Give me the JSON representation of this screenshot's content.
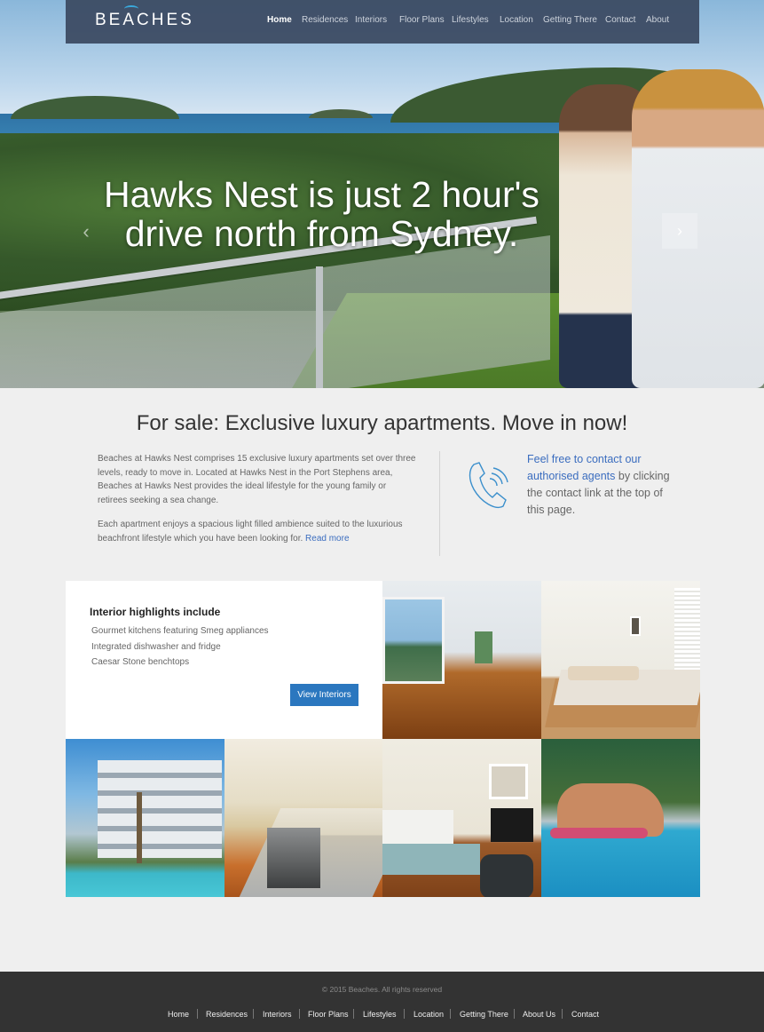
{
  "brand": {
    "logo_text": "BEACHES",
    "accent_color": "#39a9dc",
    "nav_bg": "#3a4860"
  },
  "nav": {
    "items": [
      {
        "label": "Home",
        "active": true
      },
      {
        "label": "Residences"
      },
      {
        "label": "Interiors"
      },
      {
        "label": "Floor Plans"
      },
      {
        "label": "Lifestyles"
      },
      {
        "label": "Location"
      },
      {
        "label": "Getting There"
      },
      {
        "label": "Contact"
      },
      {
        "label": "About"
      }
    ]
  },
  "hero": {
    "title_line1": "Hawks Nest is just 2 hour's",
    "title_line2": "drive north from Sydney.",
    "prev_icon": "chevron-left-icon",
    "next_icon": "chevron-right-icon",
    "prev_glyph": "‹",
    "next_glyph": "›"
  },
  "intro": {
    "title": "For sale: Exclusive luxury apartments. Move in now!",
    "paragraph1": "Beaches at Hawks Nest comprises 15 exclusive luxury apartments set over three levels, ready to move in. Located at Hawks Nest in the Port Stephens area, Beaches at Hawks Nest provides the ideal lifestyle for the young family or retirees seeking a sea change.",
    "paragraph2": "Each apartment enjoys a spacious light filled ambience suited to the luxurious beachfront lifestyle which you have been looking for.",
    "read_more": "Read more"
  },
  "contact": {
    "icon": "phone-icon",
    "link_text": "Feel free to contact our authorised agents",
    "rest_text": " by clicking the contact link at the top of this page."
  },
  "highlights": {
    "title": "Interior highlights include",
    "items": [
      "Gourmet kitchens featuring Smeg appliances",
      "Integrated dishwasher and fridge",
      "Caesar Stone benchtops"
    ],
    "button_label": "View Interiors",
    "button_color": "#2b77bf"
  },
  "footer": {
    "copyright": "© 2015 Beaches. All rights reserved",
    "links": [
      "Home",
      "Residences",
      "Interiors",
      "Floor Plans",
      "Lifestyles",
      "Location",
      "Getting There",
      "About Us",
      "Contact"
    ]
  }
}
